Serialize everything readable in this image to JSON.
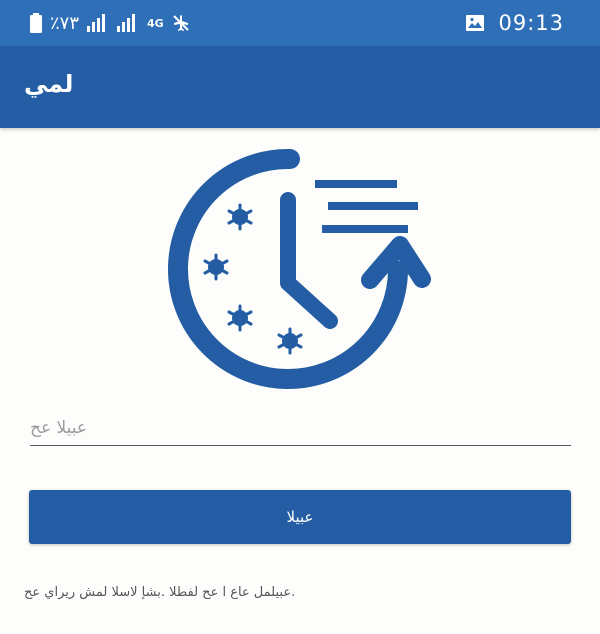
{
  "status_bar": {
    "battery_level": "٪٧٣",
    "network_label": "4G",
    "time": "09:13"
  },
  "app_bar": {
    "title": "لمي"
  },
  "login": {
    "phone_placeholder": "عبيلا عح",
    "next_button_label": "عبيلا",
    "terms_note": "عبيلمل عاع ا عح لفطلا .بشإ لاسلا لمش ريراي عح."
  },
  "colors": {
    "status_bar_bg": "#2f6fb7",
    "app_bar_bg": "#245da3",
    "logo_blue": "#245da3",
    "page_bg": "#fdfefc"
  }
}
